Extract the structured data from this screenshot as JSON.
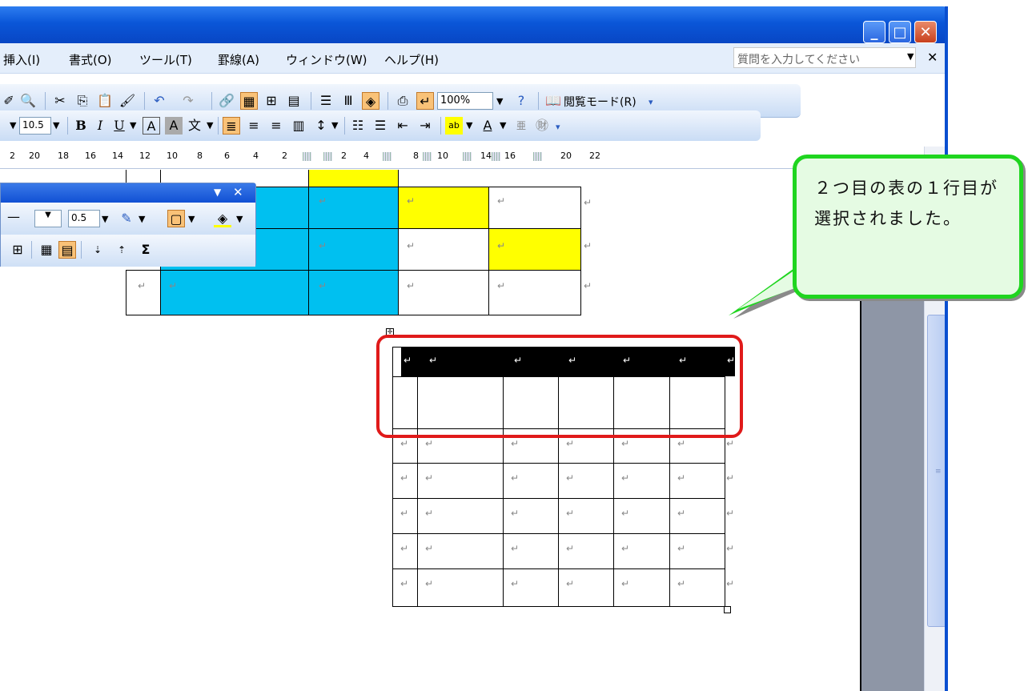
{
  "menu": [
    "挿入(I)",
    "書式(O)",
    "ツール(T)",
    "罫線(A)",
    "ウィンドウ(W)",
    "ヘルプ(H)"
  ],
  "help_box": "質問を入力してください",
  "toolbar1": {
    "zoom": "100%",
    "read_mode": "閲覧モード(R)"
  },
  "toolbar2": {
    "font_size": "10.5"
  },
  "ruler": [
    "2",
    "20",
    "18",
    "16",
    "14",
    "12",
    "10",
    "8",
    "6",
    "4",
    "2",
    "2",
    "4",
    "8",
    "10",
    "14",
    "16",
    "20",
    "22"
  ],
  "float_toolbar": {
    "line_weight": "0.5"
  },
  "callout": {
    "text": "２つ目の表の１行目が選択されました。"
  },
  "return_mark": "↵",
  "colors": {
    "cyan": "#00c0f0",
    "yellow": "#ffff00",
    "selection": "#000000",
    "highlight": "#e01a1a",
    "bubble_border": "#1fd51f"
  }
}
